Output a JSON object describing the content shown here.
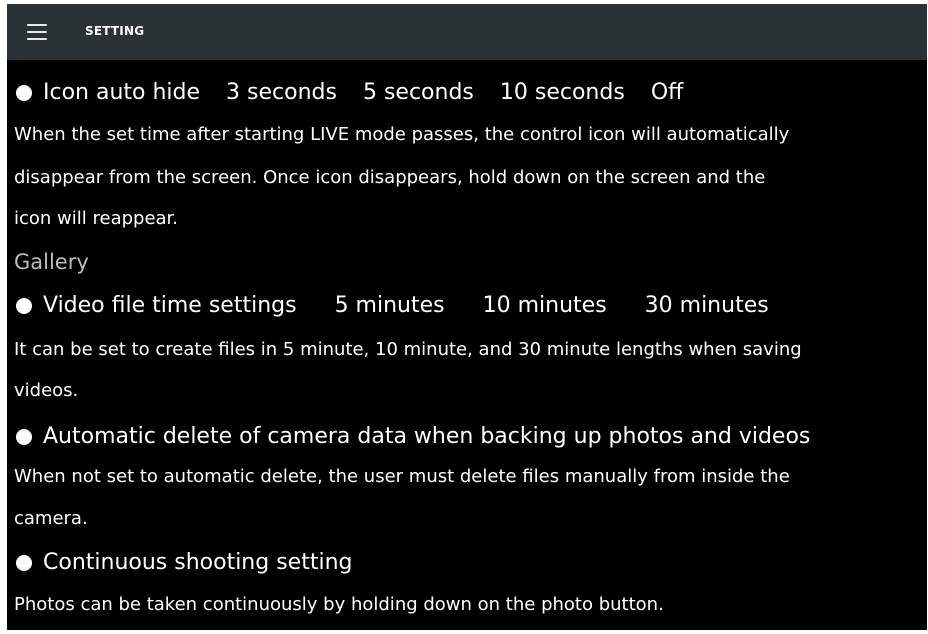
{
  "header": {
    "title": "SETTING",
    "menu_icon": "hamburger-menu-icon"
  },
  "settings": {
    "icon_auto_hide": {
      "label": "Icon auto hide",
      "options": [
        "3 seconds",
        "5 seconds",
        "10 seconds",
        "Off"
      ],
      "description_lines": [
        "When the set time after starting LIVE mode passes, the control icon will automatically",
        "disappear from the screen. Once icon disappears, hold down on the screen and the",
        "icon will reappear."
      ]
    },
    "gallery_section": "Gallery",
    "video_file_time": {
      "label": "Video file time settings",
      "options": [
        "5 minutes",
        "10 minutes",
        "30 minutes"
      ],
      "description_lines": [
        "It can be set to create files in 5 minute, 10 minute, and 30 minute lengths when saving",
        "videos."
      ]
    },
    "auto_delete": {
      "label": "Automatic delete of camera data when backing up photos and videos",
      "description_lines": [
        "When not set to automatic delete, the user must delete files manually from inside the",
        "camera."
      ]
    },
    "continuous_shooting": {
      "label": "Continuous shooting setting",
      "description_lines": [
        "Photos can be taken continuously by holding down on the photo button."
      ]
    }
  }
}
